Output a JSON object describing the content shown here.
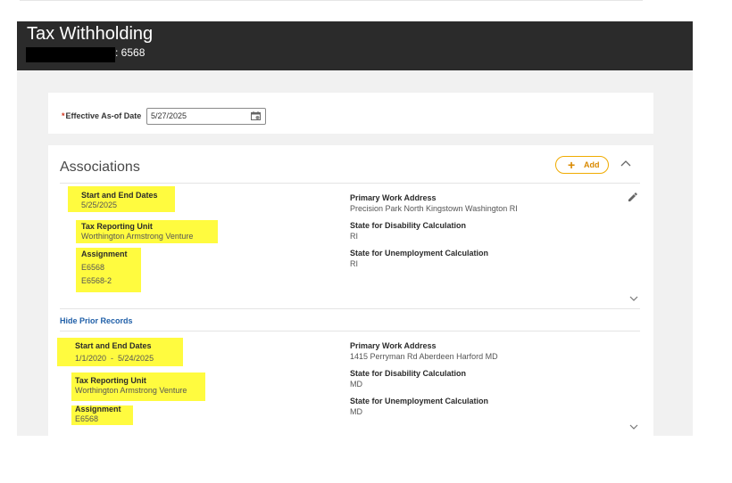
{
  "page": {
    "title": "Tax Withholding",
    "subtitle": ": 6568"
  },
  "effective": {
    "required_mark": "*",
    "label": "Effective As-of Date",
    "value": "5/27/2025"
  },
  "associations": {
    "title": "Associations",
    "add_label": "Add",
    "hide_prior_label": "Hide Prior Records",
    "records": [
      {
        "start_end_label": "Start and End Dates",
        "start_end_value": "5/25/2025",
        "tax_unit_label": "Tax Reporting Unit",
        "tax_unit_value": "Worthington Armstrong Venture",
        "assignment_label": "Assignment",
        "assignments": [
          "E6568",
          "E6568-2"
        ],
        "work_address_label": "Primary Work Address",
        "work_address_value": "Precision Park North Kingstown Washington RI",
        "disability_label": "State for Disability Calculation",
        "disability_value": "RI",
        "unemployment_label": "State for Unemployment Calculation",
        "unemployment_value": "RI"
      },
      {
        "start_end_label": "Start and End Dates",
        "start_end_value": "1/1/2020  -  5/24/2025",
        "tax_unit_label": "Tax Reporting Unit",
        "tax_unit_value": "Worthington Armstrong Venture",
        "assignment_label": "Assignment",
        "assignments": [
          "E6568"
        ],
        "work_address_label": "Primary Work Address",
        "work_address_value": "1415 Perryman Rd Aberdeen Harford MD",
        "disability_label": "State for Disability Calculation",
        "disability_value": "MD",
        "unemployment_label": "State for Unemployment Calculation",
        "unemployment_value": "MD"
      }
    ]
  },
  "icons": {
    "calendar": "calendar-icon",
    "plus": "plus-icon",
    "collapse": "chevron-up-icon",
    "edit": "pencil-icon",
    "expand": "chevron-down-icon"
  },
  "colors": {
    "header_bg": "#2b2b2b",
    "highlight": "#fffb3f",
    "add_accent": "#d98900",
    "link": "#1f5fa8"
  }
}
